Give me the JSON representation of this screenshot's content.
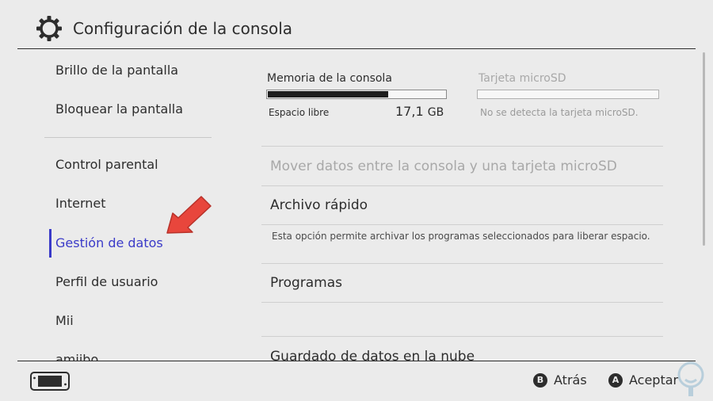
{
  "header": {
    "title": "Configuración de la consola",
    "icon": "gear-icon"
  },
  "sidebar": {
    "items": [
      {
        "label": "Brillo de la pantalla"
      },
      {
        "label": "Bloquear la pantalla"
      },
      {
        "label": "Control parental"
      },
      {
        "label": "Internet"
      },
      {
        "label": "Gestión de datos",
        "selected": true
      },
      {
        "label": "Perfil de usuario"
      },
      {
        "label": "Mii"
      },
      {
        "label": "amiibo"
      }
    ],
    "accent_color": "#3a3ac8"
  },
  "storage": {
    "console": {
      "title": "Memoria de la consola",
      "free_label": "Espacio libre",
      "free_value": "17,1",
      "free_unit": "GB",
      "used_fraction": 0.68
    },
    "microsd": {
      "title": "Tarjeta microSD",
      "status": "No se detecta la tarjeta microSD."
    }
  },
  "options": {
    "move_data": "Mover datos entre la consola y una tarjeta microSD",
    "quick_archive": "Archivo rápido",
    "quick_archive_desc": "Esta opción permite archivar los programas seleccionados para liberar espacio.",
    "programs": "Programas",
    "cloud_save": "Guardado de datos en la nube"
  },
  "footer": {
    "back_key": "B",
    "back_label": "Atrás",
    "accept_key": "A",
    "accept_label": "Aceptar",
    "device_icon": "switch-console-icon"
  },
  "annotation": {
    "arrow_color": "#e8463c"
  }
}
